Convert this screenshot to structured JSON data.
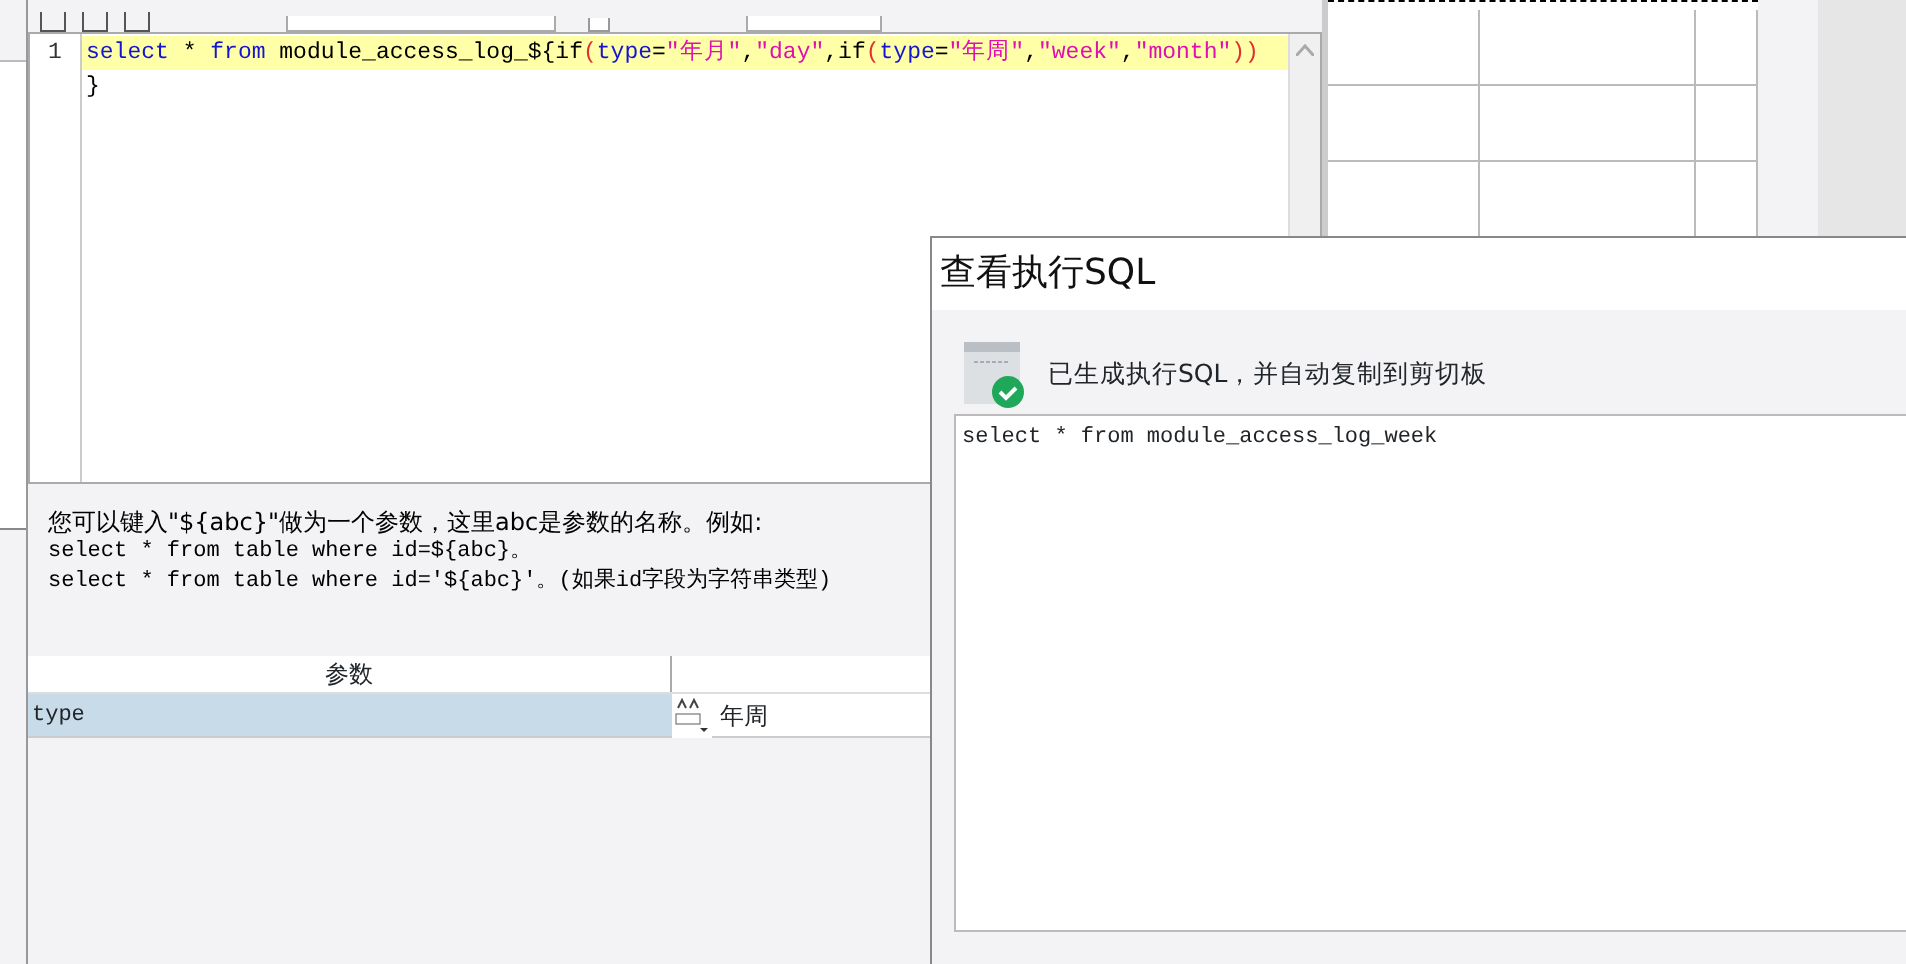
{
  "toolbar": {
    "checkbox_checked": false
  },
  "editor": {
    "line_numbers": [
      "1"
    ],
    "lines": [
      {
        "current": true,
        "tokens": [
          {
            "text": "select",
            "kind": "keyword"
          },
          {
            "text": " * ",
            "kind": "plain"
          },
          {
            "text": "from",
            "kind": "keyword"
          },
          {
            "text": " module_access_log_${if",
            "kind": "plain"
          },
          {
            "text": "(",
            "kind": "paren"
          },
          {
            "text": "type",
            "kind": "keyword"
          },
          {
            "text": "=",
            "kind": "plain"
          },
          {
            "text": "\"年月\"",
            "kind": "string"
          },
          {
            "text": ",",
            "kind": "plain"
          },
          {
            "text": "\"day\"",
            "kind": "string"
          },
          {
            "text": ",if",
            "kind": "plain"
          },
          {
            "text": "(",
            "kind": "paren"
          },
          {
            "text": "type",
            "kind": "keyword"
          },
          {
            "text": "=",
            "kind": "plain"
          },
          {
            "text": "\"年周\"",
            "kind": "string"
          },
          {
            "text": ",",
            "kind": "plain"
          },
          {
            "text": "\"week\"",
            "kind": "string"
          },
          {
            "text": ",",
            "kind": "plain"
          },
          {
            "text": "\"month\"",
            "kind": "string"
          },
          {
            "text": "))",
            "kind": "paren"
          }
        ]
      },
      {
        "current": false,
        "tokens": [
          {
            "text": "}",
            "kind": "plain"
          }
        ]
      }
    ]
  },
  "hint": [
    "您可以键入\"${abc}\"做为一个参数，这里abc是参数的名称。例如:",
    "select * from table where id=${abc}。",
    "select * from table where id='${abc}'。(如果id字段为字符串类型)"
  ],
  "params": {
    "columns": [
      "参数"
    ],
    "rows": [
      {
        "name": "type",
        "value": "年周",
        "selected": true
      }
    ]
  },
  "sql_dialog": {
    "title": "查看执行SQL",
    "message": "已生成执行SQL，并自动复制到剪切板",
    "sql": "select * from module_access_log_week"
  }
}
